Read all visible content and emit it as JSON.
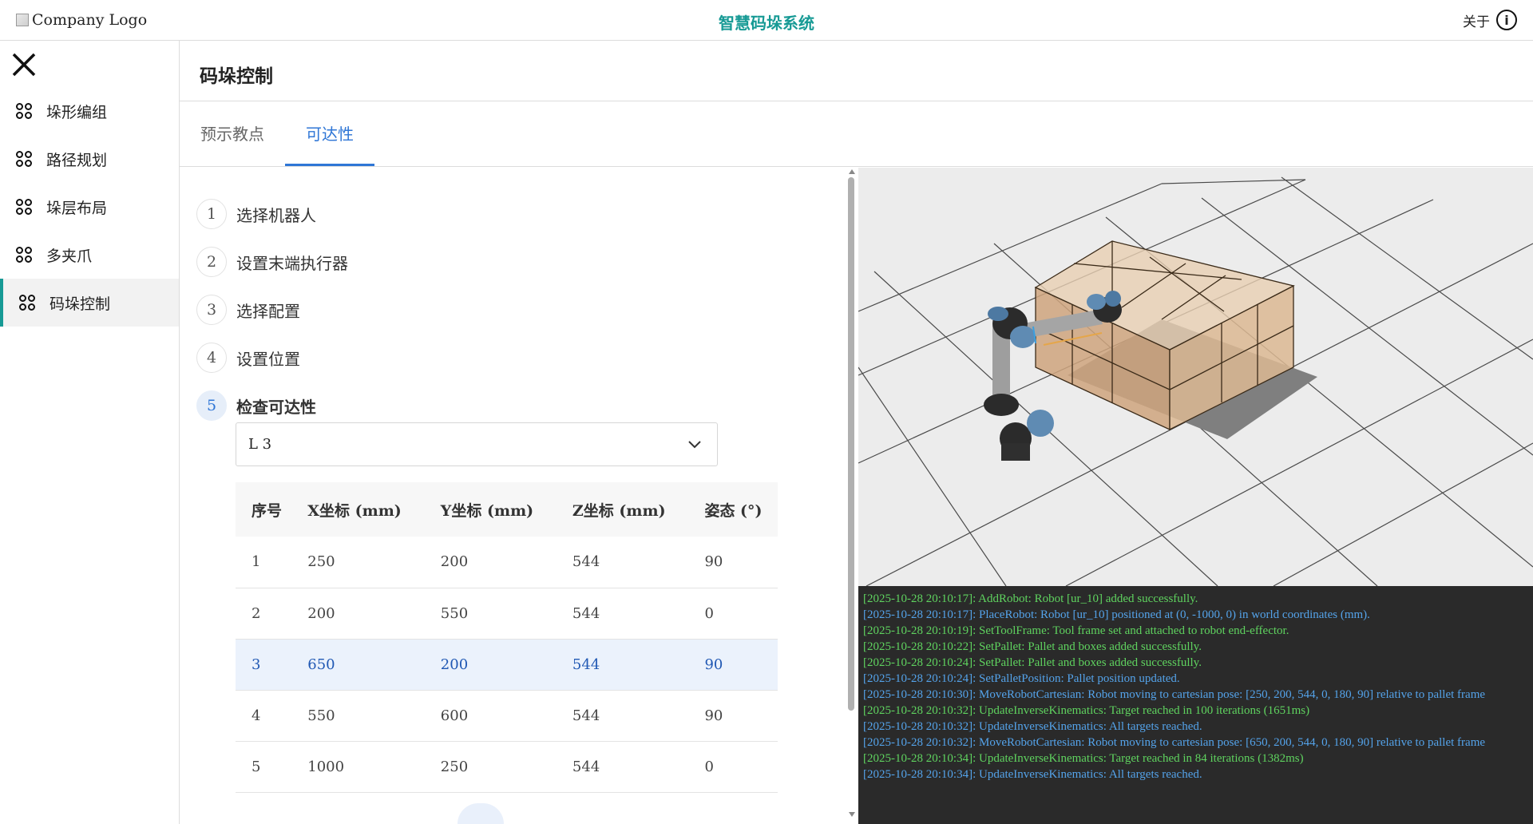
{
  "header": {
    "logo_alt": "Company Logo",
    "title": "智慧码垛系统",
    "about_label": "关于",
    "about_icon": "info-icon"
  },
  "sidebar": {
    "close_icon": "close-icon",
    "items": [
      {
        "label": "垛形编组",
        "icon": "grid-icon",
        "active": false
      },
      {
        "label": "路径规划",
        "icon": "grid-icon",
        "active": false
      },
      {
        "label": "垛层布局",
        "icon": "grid-icon",
        "active": false
      },
      {
        "label": "多夹爪",
        "icon": "grid-icon",
        "active": false
      },
      {
        "label": "码垛控制",
        "icon": "grid-icon",
        "active": true
      }
    ],
    "accent_color": "#179a95"
  },
  "main": {
    "title": "码垛控制",
    "tabs": [
      {
        "label": "预示教点",
        "active": false
      },
      {
        "label": "可达性",
        "active": true
      }
    ],
    "steps": [
      {
        "num": "1",
        "label": "选择机器人",
        "active": false
      },
      {
        "num": "2",
        "label": "设置末端执行器",
        "active": false
      },
      {
        "num": "3",
        "label": "选择配置",
        "active": false
      },
      {
        "num": "4",
        "label": "设置位置",
        "active": false
      },
      {
        "num": "5",
        "label": "检查可达性",
        "active": true
      }
    ],
    "layer_select": {
      "value": "L 3",
      "icon": "chevron-down-icon"
    },
    "table": {
      "headers": [
        "序号",
        "X坐标 (mm)",
        "Y坐标 (mm)",
        "Z坐标 (mm)",
        "姿态 (°)"
      ],
      "rows": [
        [
          "1",
          "250",
          "200",
          "544",
          "90"
        ],
        [
          "2",
          "200",
          "550",
          "544",
          "0"
        ],
        [
          "3",
          "650",
          "200",
          "544",
          "90"
        ],
        [
          "4",
          "550",
          "600",
          "544",
          "90"
        ],
        [
          "5",
          "1000",
          "250",
          "544",
          "0"
        ]
      ],
      "selected_row": 3
    }
  },
  "console": {
    "lines": [
      {
        "level": "success",
        "text": "[2025-10-28 20:10:17]: AddRobot: Robot [ur_10] added successfully."
      },
      {
        "level": "info",
        "text": "[2025-10-28 20:10:17]: PlaceRobot: Robot [ur_10] positioned at (0, -1000, 0) in world coordinates (mm)."
      },
      {
        "level": "success",
        "text": "[2025-10-28 20:10:19]: SetToolFrame: Tool frame set and attached to robot end-effector."
      },
      {
        "level": "success",
        "text": "[2025-10-28 20:10:22]: SetPallet: Pallet and boxes added successfully."
      },
      {
        "level": "success",
        "text": "[2025-10-28 20:10:24]: SetPallet: Pallet and boxes added successfully."
      },
      {
        "level": "info",
        "text": "[2025-10-28 20:10:24]: SetPalletPosition: Pallet position updated."
      },
      {
        "level": "info",
        "text": "[2025-10-28 20:10:30]: MoveRobotCartesian: Robot moving to cartesian pose: [250, 200, 544, 0, 180, 90] relative to pallet frame"
      },
      {
        "level": "success",
        "text": "[2025-10-28 20:10:32]: UpdateInverseKinematics: Target reached in 100 iterations (1651ms)"
      },
      {
        "level": "info",
        "text": "[2025-10-28 20:10:32]: UpdateInverseKinematics: All targets reached."
      },
      {
        "level": "info",
        "text": "[2025-10-28 20:10:32]: MoveRobotCartesian: Robot moving to cartesian pose: [650, 200, 544, 0, 180, 90] relative to pallet frame"
      },
      {
        "level": "success",
        "text": "[2025-10-28 20:10:34]: UpdateInverseKinematics: Target reached in 84 iterations (1382ms)"
      },
      {
        "level": "info",
        "text": "[2025-10-28 20:10:34]: UpdateInverseKinematics: All targets reached."
      }
    ],
    "colors": {
      "success": "#5fd35f",
      "info": "#54a3ea",
      "background": "#2a2a2a"
    }
  }
}
